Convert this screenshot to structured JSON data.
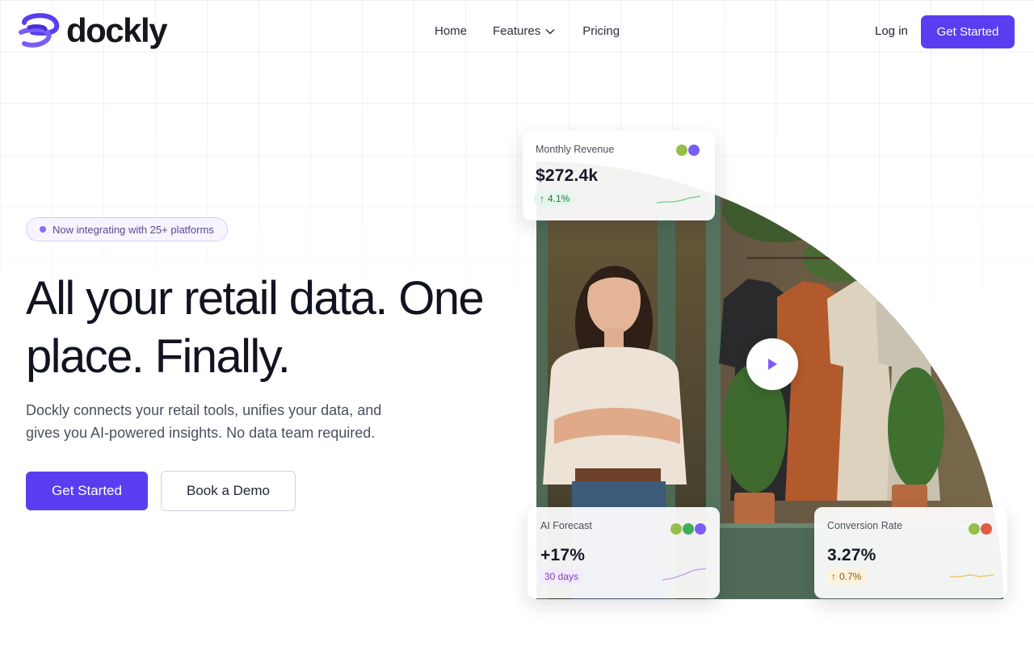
{
  "brand": {
    "name": "dockly",
    "accent": "#5a3df0"
  },
  "nav": {
    "links": [
      {
        "label": "Home"
      },
      {
        "label": "Features"
      },
      {
        "label": "Pricing"
      }
    ],
    "login": "Log in",
    "cta": "Get Started"
  },
  "hero": {
    "badge": "Now integrating with 25+ platforms",
    "headline_line1": "All your retail data. One",
    "headline_line2": "place. Finally.",
    "subtext_line1": "Dockly connects your retail tools, unifies your data, and",
    "subtext_line2": "gives you AI-powered insights. No data team required.",
    "primary_cta": "Get Started",
    "secondary_cta": "Book a Demo"
  },
  "cards": {
    "revenue": {
      "title": "Monthly Revenue",
      "value": "$272.4k",
      "change": "4.1%",
      "change_color": "#1a9c4a"
    },
    "forecast": {
      "title": "AI Forecast",
      "value": "+17%",
      "tag": "30 days",
      "tag_color": "#7b3fc4"
    },
    "conversion": {
      "title": "Conversion Rate",
      "value": "3.27%",
      "change": "0.7%",
      "change_color": "#b7791f"
    }
  },
  "icons": {
    "nav_dropdown": "chevron-down-icon",
    "play": "play-icon",
    "up_arrow": "arrow-up-icon"
  }
}
